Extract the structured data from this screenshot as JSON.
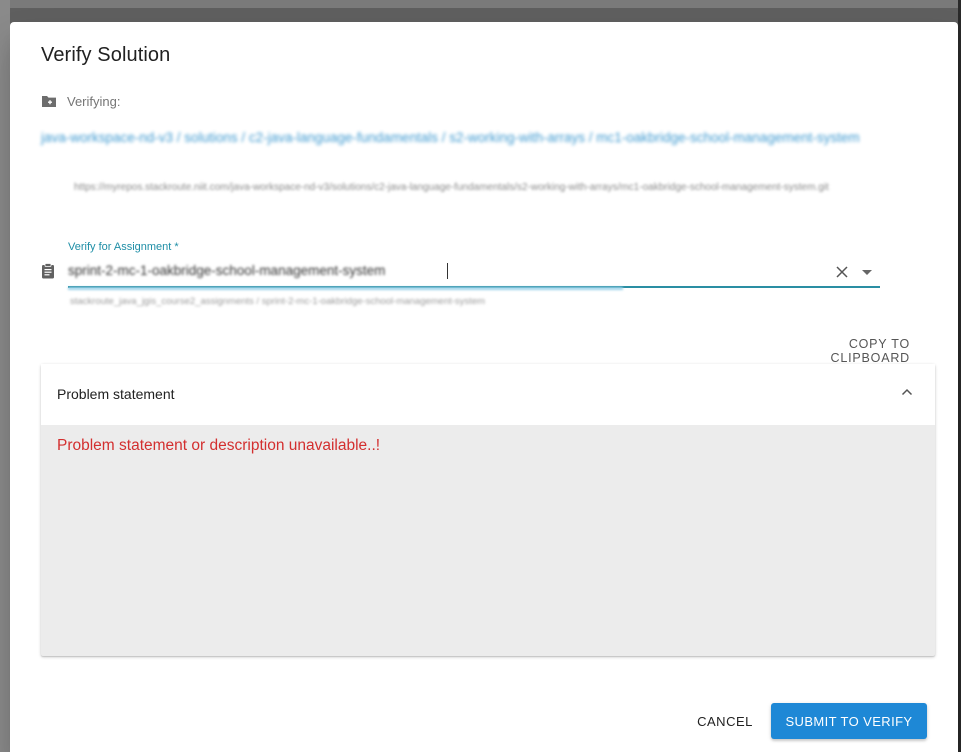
{
  "dialog": {
    "title": "Verify Solution",
    "verifying_label": "Verifying:",
    "repo_path": "java-workspace-nd-v3 / solutions / c2-java-language-fundamentals / s2-working-with-arrays / mc1-oakbridge-school-management-system",
    "repo_url": "https://myrepos.stackroute.niit.com/java-workspace-nd-v3/solutions/c2-java-language-fundamentals/s2-working-with-arrays/mc1-oakbridge-school-management-system.git",
    "assignment_field": {
      "label": "Verify for Assignment *",
      "value": "sprint-2-mc-1-oakbridge-school-management-system",
      "hint": "stackroute_java_jgis_course2_assignments / sprint-2-mc-1-oakbridge-school-management-system"
    },
    "copy_label": "COPY TO CLIPBOARD",
    "panel": {
      "title": "Problem statement",
      "message": "Problem statement or description unavailable..!"
    },
    "cancel_label": "CANCEL",
    "submit_label": "SUBMIT TO VERIFY"
  },
  "colors": {
    "accent": "#1e88d6",
    "field_accent": "#2a8ea3",
    "error": "#d32f2f",
    "link": "#1e88c8"
  }
}
